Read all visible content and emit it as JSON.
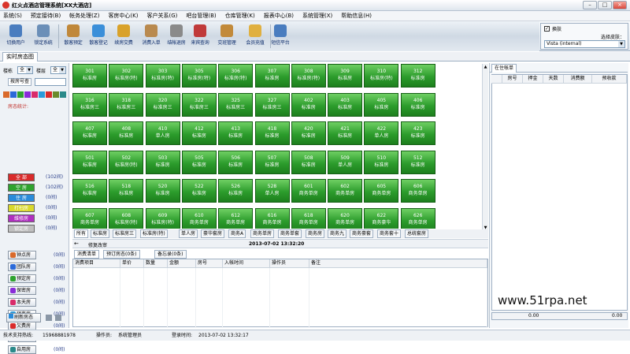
{
  "window": {
    "title": "红火点酒店管理系统[XX大酒店]",
    "min": "–",
    "max": "□",
    "close": "×"
  },
  "menu": [
    "系统(S)",
    "预定接待(B)",
    "帐务处理(Z)",
    "客房中心(K)",
    "客户关系(G)",
    "吧台管理(B)",
    "仓库管理(K)",
    "报表中心(B)",
    "系统管理(X)",
    "帮助信息(H)"
  ],
  "toolbar": [
    {
      "label": "切换用户",
      "icon": "switch-user-icon",
      "color": "#4a7dbf"
    },
    {
      "label": "锁定系统",
      "icon": "lock-system-icon",
      "color": "#6b8fb8"
    },
    {
      "label": "散客预定",
      "icon": "booking-icon",
      "color": "#c0883a"
    },
    {
      "label": "散客登记",
      "icon": "checkin-icon",
      "color": "#3b8fd9"
    },
    {
      "label": "续房交费",
      "icon": "extend-stay-icon",
      "color": "#d9a22a"
    },
    {
      "label": "消费入单",
      "icon": "consume-order-icon",
      "color": "#b98a4f"
    },
    {
      "label": "结帐退房",
      "icon": "checkout-icon",
      "color": "#8a8a8a"
    },
    {
      "label": "来宾查询",
      "icon": "guest-query-icon",
      "color": "#c03a3a"
    },
    {
      "label": "交班管理",
      "icon": "shift-icon",
      "color": "#c28a3a"
    },
    {
      "label": "会员充值",
      "icon": "member-recharge-icon",
      "color": "#e0b040"
    },
    {
      "label": "短信平台",
      "icon": "sms-icon",
      "color": "#4a7dbf"
    }
  ],
  "skin": {
    "checkbox_label": "换肤",
    "select_label": "选择皮肤：",
    "value": "Vista (internal)"
  },
  "tabs": {
    "realtime": "实时房态图"
  },
  "left": {
    "floor_label": "楼栋",
    "floor_value": "全",
    "storey_label": "楼层",
    "storey_value": "全",
    "roomno_label": "按房号查",
    "stats_title": "房态统计:",
    "stats": [
      {
        "label": "全 部",
        "count": "(102间)",
        "color": "#d92b2b"
      },
      {
        "label": "空 房",
        "count": "(102间)",
        "color": "#2fa32f"
      },
      {
        "label": "住 房",
        "count": "(0间)",
        "color": "#2a8bd9"
      },
      {
        "label": "打扫房",
        "count": "(0间)",
        "color": "#d9d92b"
      },
      {
        "label": "维修房",
        "count": "(0间)",
        "color": "#b030c0"
      },
      {
        "label": "锁定房",
        "count": "(0间)",
        "color": "#c0c0c0"
      }
    ],
    "chips": [
      {
        "label": "钟点房",
        "count": "(0间)",
        "color": "#d96a2b"
      },
      {
        "label": "团队房",
        "count": "(0间)",
        "color": "#2b6ad9"
      },
      {
        "label": "预定房",
        "count": "(0间)",
        "color": "#2fa32f"
      },
      {
        "label": "保密房",
        "count": "(0间)",
        "color": "#8a2bd9"
      },
      {
        "label": "本天房",
        "count": "(0间)",
        "color": "#d92b6a"
      },
      {
        "label": "预离房",
        "count": "(0间)",
        "color": "#2b9ad9"
      },
      {
        "label": "欠费房",
        "count": "(0间)",
        "color": "#d92b2b"
      },
      {
        "label": "长包房",
        "count": "(0间)",
        "color": "#6a8a2b"
      },
      {
        "label": "自用房",
        "count": "(0间)",
        "color": "#2b8a8a"
      }
    ],
    "refresh": "刷新房态"
  },
  "rooms": [
    [
      "301",
      "标准房"
    ],
    [
      "302",
      "标准房(特)"
    ],
    [
      "303",
      "标准房(特)"
    ],
    [
      "305",
      "标准房(特)"
    ],
    [
      "306",
      "标准房(特)"
    ],
    [
      "307",
      "标准房"
    ],
    [
      "308",
      "标准房(特)"
    ],
    [
      "309",
      "标准房"
    ],
    [
      "310",
      "标准房(特)"
    ],
    [
      "312",
      "标准房"
    ],
    [
      "316",
      "标准房三"
    ],
    [
      "318",
      "标准房三"
    ],
    [
      "320",
      "标准房三"
    ],
    [
      "322",
      "标准房三"
    ],
    [
      "325",
      "标准房三"
    ],
    [
      "327",
      "标准房三"
    ],
    [
      "402",
      "标准房"
    ],
    [
      "403",
      "标准房"
    ],
    [
      "405",
      "标准房"
    ],
    [
      "406",
      "标准房"
    ],
    [
      "407",
      "标准房"
    ],
    [
      "408",
      "标准房"
    ],
    [
      "410",
      "单人房"
    ],
    [
      "412",
      "标准房"
    ],
    [
      "413",
      "标准房"
    ],
    [
      "418",
      "标准房"
    ],
    [
      "420",
      "标准房"
    ],
    [
      "421",
      "标准房"
    ],
    [
      "422",
      "单人房"
    ],
    [
      "423",
      "标准房"
    ],
    [
      "501",
      "标准房"
    ],
    [
      "502",
      "标准房(特)"
    ],
    [
      "503",
      "标准房"
    ],
    [
      "505",
      "标准房"
    ],
    [
      "506",
      "标准房"
    ],
    [
      "507",
      "标准房"
    ],
    [
      "508",
      "标准房"
    ],
    [
      "509",
      "单人房"
    ],
    [
      "510",
      "标准房"
    ],
    [
      "512",
      "标准房"
    ],
    [
      "516",
      "标准房"
    ],
    [
      "518",
      "标准房"
    ],
    [
      "520",
      "标准房"
    ],
    [
      "522",
      "标准房"
    ],
    [
      "526",
      "标准房"
    ],
    [
      "528",
      "单人房"
    ],
    [
      "601",
      "商务单房"
    ],
    [
      "602",
      "商务单房"
    ],
    [
      "605",
      "商务单房"
    ],
    [
      "606",
      "商务单房"
    ],
    [
      "607",
      "商务单房"
    ],
    [
      "608",
      "标准房(特)"
    ],
    [
      "609",
      "标准房(特)"
    ],
    [
      "610",
      "商务单房"
    ],
    [
      "612",
      "商务单房"
    ],
    [
      "616",
      "商务单房"
    ],
    [
      "618",
      "商务单房"
    ],
    [
      "620",
      "商务单房"
    ],
    [
      "622",
      "商务豪华"
    ],
    [
      "626",
      "商务单房"
    ]
  ],
  "room_types": [
    "所有",
    "标准房",
    "标准房三",
    "标准房(特)",
    "单人房",
    "豪华套房",
    "商务A",
    "商务单房",
    "商务单套",
    "商务房",
    "商务九",
    "商务豪套",
    "商务套十",
    "总统套房"
  ],
  "info": {
    "label": "修复改审",
    "datetime": "2013-07-02  13:32:20"
  },
  "consume_tabs": [
    "消费清单",
    "预订房态(0条)",
    "备忘录(0条)"
  ],
  "consume_headers": [
    "消费项目",
    "单价",
    "数量",
    "金额",
    "房号",
    "入帐时间",
    "操作员",
    "备注"
  ],
  "account": {
    "tab": "在住帐单",
    "headers": [
      "房号",
      "押金",
      "天数",
      "消费额",
      "预收款"
    ],
    "total1": "0.00",
    "total2": "0.00"
  },
  "status": {
    "support_label": "技术支持热线:",
    "support_phone": "15968881978",
    "operator_label": "操作员:",
    "operator": "系统管理员",
    "login_label": "登录时间:",
    "login_time": "2013-07-02 13:32:17"
  },
  "watermark": "www.51rpa.net"
}
